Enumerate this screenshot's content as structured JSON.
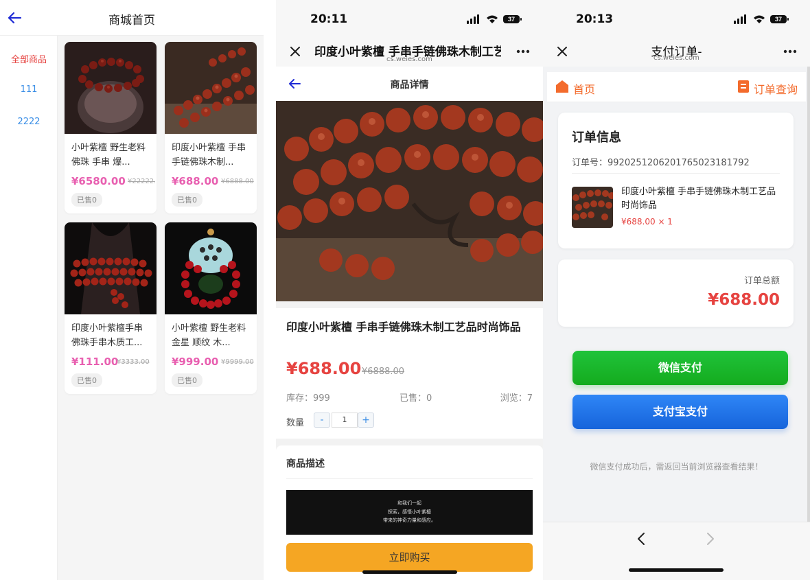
{
  "panel1": {
    "header": {
      "title": "商城首页"
    },
    "categories": [
      {
        "label": "全部商品",
        "active": true
      },
      {
        "label": "111",
        "active": false
      },
      {
        "label": "2222",
        "active": false
      }
    ],
    "products": [
      {
        "name": "小叶紫檀 野生老料 佛珠 手串 爆...",
        "price": "¥6580.00",
        "old_price": "¥22222.",
        "sold": "已售0"
      },
      {
        "name": "印度小叶紫檀 手串手链佛珠木制...",
        "price": "¥688.00",
        "old_price": "¥6888.00",
        "sold": "已售0"
      },
      {
        "name": "印度小叶紫檀手串佛珠手串木质工...",
        "price": "¥111.00",
        "old_price": "¥3333.00",
        "sold": "已售0"
      },
      {
        "name": "小叶紫檀 野生老料金星 顺纹 木...",
        "price": "¥999.00",
        "old_price": "¥9999.00",
        "sold": "已售0"
      }
    ]
  },
  "panel2": {
    "status": {
      "time": "20:11",
      "battery": "37"
    },
    "nav": {
      "title": "印度小叶紫檀 手串手链佛珠木制工艺",
      "domain": "cs.weies.com"
    },
    "subheader": {
      "title": "商品详情"
    },
    "product": {
      "name": "印度小叶紫檀 手串手链佛珠木制工艺品时尚饰品",
      "price": "¥688.00",
      "old_price": "¥6888.00",
      "stock": "库存：999",
      "sold": "已售：0",
      "views": "浏览：7",
      "qty_label": "数量",
      "qty_minus": "-",
      "qty_value": "1",
      "qty_plus": "+"
    },
    "description": {
      "title": "商品描述",
      "banner_line1": "和我们一起",
      "banner_line2": "探索，感悟小叶紫檀",
      "banner_line3": "带来的神奇力量和感应。"
    },
    "buy_button": "立即购买"
  },
  "panel3": {
    "status": {
      "time": "20:13",
      "battery": "37"
    },
    "nav": {
      "title": "支付订单-",
      "domain": "cs.weies.com"
    },
    "topnav": {
      "home": "首页",
      "query": "订单查询"
    },
    "order": {
      "title": "订单信息",
      "number": "订单号：992025120620176502318179​2",
      "product_name": "印度小叶紫檀 手串手链佛珠木制工艺品时尚饰品",
      "product_price": "¥688.00 × 1"
    },
    "total": {
      "label": "订单总额",
      "amount": "¥688.00"
    },
    "wechat_pay": "微信支付",
    "alipay": "支付宝支付",
    "note": "微信支付成功后，需返回当前浏览器查看结果！"
  },
  "colors": {
    "accent_red": "#e64340",
    "pink_price": "#e85fb0",
    "link_blue": "#3a8ee6",
    "orange": "#f36b2c",
    "buy_yellow": "#f5a623",
    "wechat_green": "#14ab1e",
    "alipay_blue": "#1664db"
  }
}
